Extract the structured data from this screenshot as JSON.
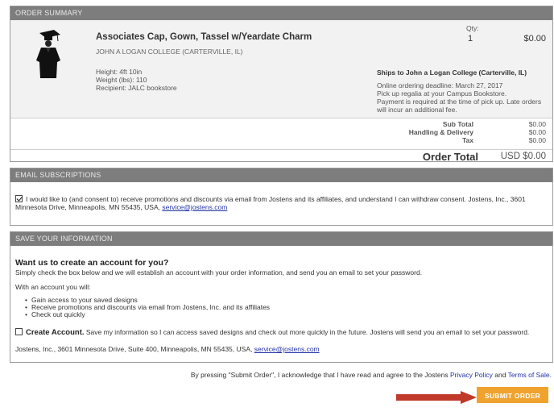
{
  "order_summary": {
    "header": "ORDER SUMMARY",
    "product_title": "Associates Cap, Gown, Tassel w/Yeardate Charm",
    "college": "JOHN A LOGAN COLLEGE (CARTERVILLE, IL)",
    "qty_label": "Qty:",
    "qty_value": "1",
    "price": "$0.00",
    "height": "Height: 4ft 10in",
    "weight": "Weight (lbs): 110",
    "recipient": "Recipient: JALC bookstore",
    "ships_to": "Ships to John a Logan College (Carterville, IL)",
    "deadline": "Online ordering deadline: March 27, 2017",
    "pickup": "Pick up regalia at your Campus Bookstore.",
    "payment": "Payment is required at the time of pick up. Late orders will incur an additional fee.",
    "subtotal_label": "Sub Total",
    "subtotal_value": "$0.00",
    "handling_label": "Handling & Delivery",
    "handling_value": "$0.00",
    "tax_label": "Tax",
    "tax_value": "$0.00",
    "total_label": "Order Total",
    "total_value": "USD $0.00"
  },
  "email": {
    "header": "EMAIL SUBSCRIPTIONS",
    "consent_checked": true,
    "consent_text": "I would like to (and consent to) receive promotions and discounts via email from Jostens and its affiliates, and understand I can withdraw consent. Jostens, Inc., 3601 Minnesota Drive, Minneapolis, MN 55435, USA,",
    "email_link": "service@jostens.com"
  },
  "save_info": {
    "header": "SAVE YOUR INFORMATION",
    "title": "Want us to create an account for you?",
    "subtitle": "Simply check the box below and we will establish an account with your order information, and send you an email to set your password.",
    "with_account": "With an account you will:",
    "benefits": [
      "Gain access to your saved designs",
      "Receive promotions and discounts via email from Jostens, Inc. and its affiliates",
      "Check out quickly"
    ],
    "create_checked": false,
    "create_label": "Create Account.",
    "create_text": "Save my information so I can access saved designs and check out more quickly in the future. Jostens will send you an email to set your password.",
    "address": "Jostens, Inc., 3601 Minnesota Drive, Suite 400, Minneapolis, MN 55435, USA,",
    "address_link": "service@jostens.com"
  },
  "footer": {
    "agree_text": "By pressing \"Submit Order\", I acknowledge that I have read and agree to the Jostens",
    "privacy": "Privacy Policy",
    "and": "and",
    "terms": "Terms of Sale.",
    "submit": "SUBMIT ORDER ▶"
  },
  "colors": {
    "header_bg": "#7d7d7d",
    "submit_bg": "#f0a22e",
    "link": "#2233aa",
    "arrow": "#c0392b"
  },
  "icons": {
    "checkbox_checked": "checkmark",
    "gown_image": "graduation-gown"
  }
}
